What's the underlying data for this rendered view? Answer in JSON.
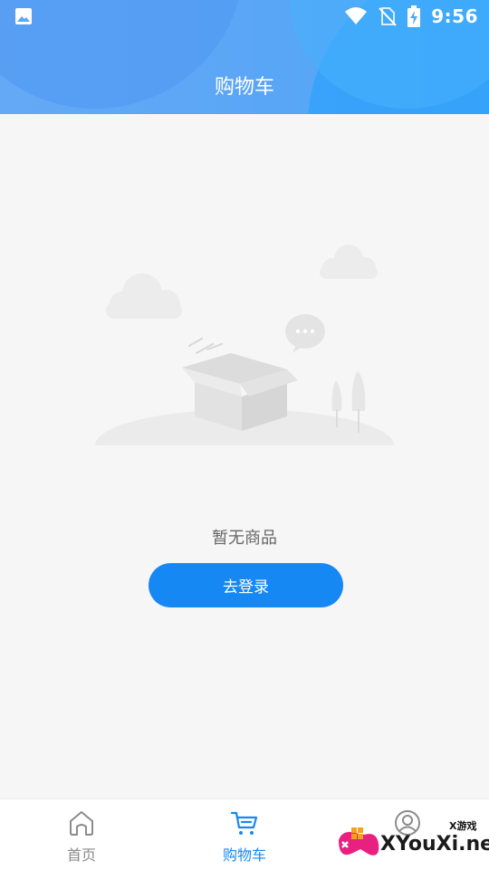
{
  "status_bar": {
    "time": "9:56",
    "icons": [
      "image-icon",
      "wifi-icon",
      "no-sim-icon",
      "battery-charging-icon"
    ]
  },
  "header": {
    "title": "购物车"
  },
  "empty_state": {
    "illustration": "empty-box-illustration",
    "message": "暂无商品",
    "button_label": "去登录"
  },
  "tab_bar": {
    "items": [
      {
        "label": "首页",
        "icon": "home-icon",
        "active": false
      },
      {
        "label": "购物车",
        "icon": "cart-icon",
        "active": true
      },
      {
        "label": "",
        "icon": "profile-icon",
        "active": false
      }
    ]
  },
  "watermark": {
    "small_text": "X游戏",
    "brand_text": "XYouXi.net"
  },
  "colors": {
    "accent": "#1688f4",
    "header_gradient_start": "#64a9f5",
    "header_gradient_end": "#4fa3f8",
    "background": "#f6f6f6",
    "tab_inactive": "#8b8b8b"
  }
}
